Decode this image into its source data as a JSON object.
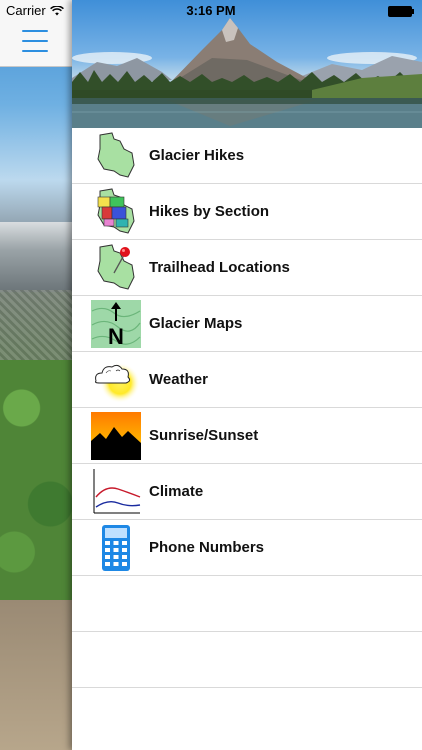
{
  "status_bar": {
    "carrier": "Carrier",
    "time": "3:16 PM"
  },
  "nav": {
    "menu_icon": "hamburger-menu-icon"
  },
  "menu": {
    "items": [
      {
        "label": "Glacier Hikes",
        "icon": "park-map-icon"
      },
      {
        "label": "Hikes by Section",
        "icon": "section-map-icon"
      },
      {
        "label": "Trailhead Locations",
        "icon": "map-pin-icon"
      },
      {
        "label": "Glacier Maps",
        "icon": "topo-map-north-icon"
      },
      {
        "label": "Weather",
        "icon": "sun-cloud-icon"
      },
      {
        "label": "Sunrise/Sunset",
        "icon": "sunset-mountain-icon"
      },
      {
        "label": "Climate",
        "icon": "climate-chart-icon"
      },
      {
        "label": "Phone Numbers",
        "icon": "calculator-phone-icon"
      }
    ]
  },
  "colors": {
    "accent": "#2d8fe0"
  }
}
